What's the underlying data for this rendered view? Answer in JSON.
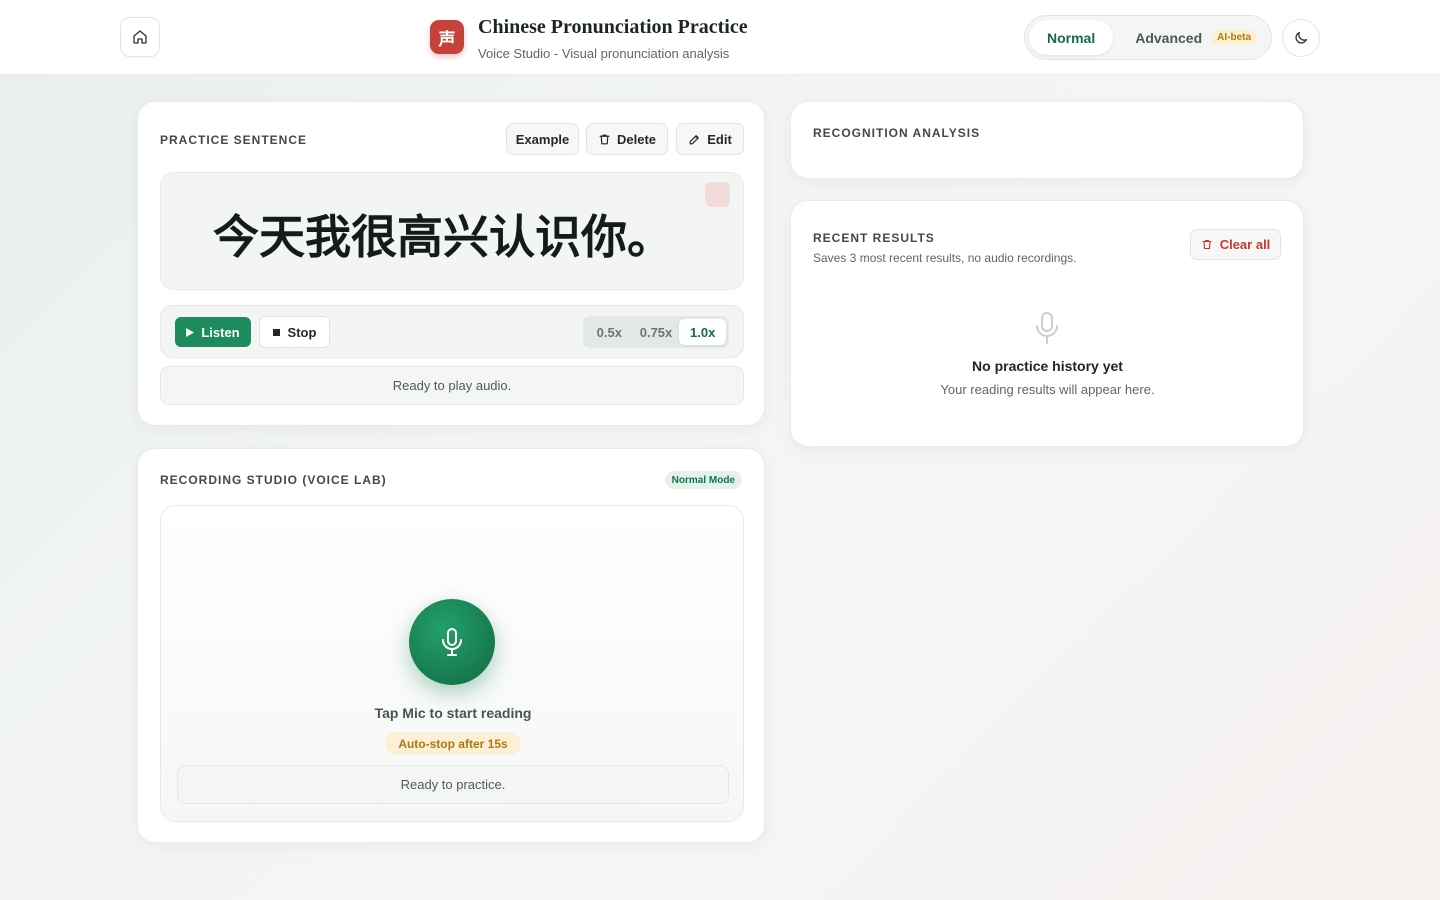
{
  "header": {
    "logo_char": "声",
    "title": "Chinese Pronunciation Practice",
    "subtitle": "Voice Studio - Visual pronunciation analysis",
    "modes": [
      {
        "label": "Normal",
        "active": true
      },
      {
        "label": "Advanced",
        "badge": "AI-beta",
        "active": false
      }
    ],
    "icons": {
      "home": "home-icon",
      "theme": "moon-icon"
    }
  },
  "practice": {
    "title": "PRACTICE SENTENCE",
    "buttons": {
      "example": "Example",
      "delete": "Delete",
      "edit": "Edit"
    },
    "sentence": "今天我很高兴认识你。",
    "listen_label": "Listen",
    "stop_label": "Stop",
    "speeds": [
      "0.5x",
      "0.75x",
      "1.0x"
    ],
    "active_speed": "1.0x",
    "status": "Ready to play audio."
  },
  "recording": {
    "title": "RECORDING STUDIO (VOICE LAB)",
    "mode_badge": "Normal Mode",
    "tap_text": "Tap Mic to start reading",
    "autostop": "Auto-stop after 15s",
    "status": "Ready to practice."
  },
  "analysis": {
    "title": "RECOGNITION ANALYSIS"
  },
  "results": {
    "title": "RECENT RESULTS",
    "subtitle": "Saves 3 most recent results, no audio recordings.",
    "clear_label": "Clear all",
    "empty_title": "No practice history yet",
    "empty_sub": "Your reading results will appear here."
  },
  "colors": {
    "brand_green": "#1e8b5c",
    "logo_red": "#c4423a",
    "warn_amber": "#b07612",
    "danger_red": "#c43a31"
  }
}
